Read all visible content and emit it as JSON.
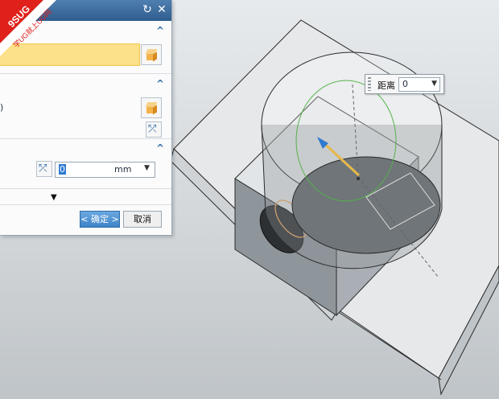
{
  "watermark": {
    "line1": "9SUG",
    "line2": "学UG就上UG网"
  },
  "dialog": {
    "section3": {
      "input_value": "0",
      "unit": "mm"
    },
    "buttons": {
      "ok": "< 确定 >",
      "cancel": "取消"
    }
  },
  "distance_popup": {
    "label": "距离",
    "value": "0"
  }
}
